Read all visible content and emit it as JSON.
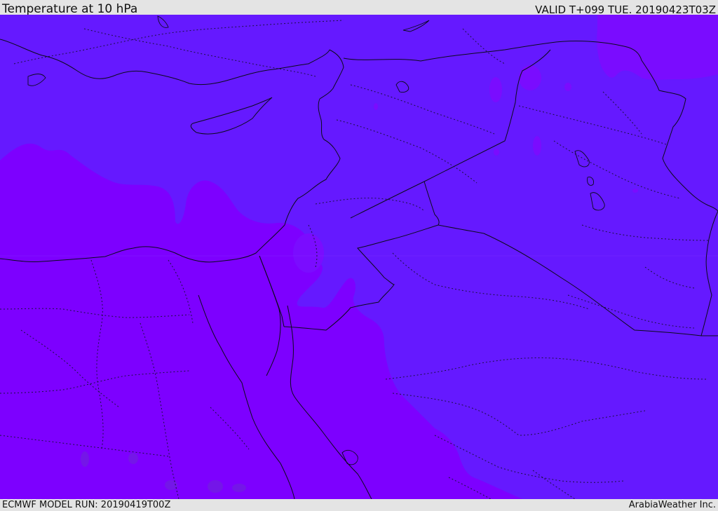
{
  "header": {
    "title": "Temperature at 10 hPa",
    "valid": "VALID T+099 TUE. 20190423T03Z"
  },
  "footer": {
    "model_run": "ECMWF MODEL RUN: 20190419T00Z",
    "credit": "ArabiaWeather Inc."
  },
  "map": {
    "colors": {
      "cold_band": "#6519ff",
      "colder_band": "#7d00ff",
      "blob": "#7a0cff",
      "coastline": "#0b0b1a",
      "border_dotted": "#1a1040"
    }
  }
}
